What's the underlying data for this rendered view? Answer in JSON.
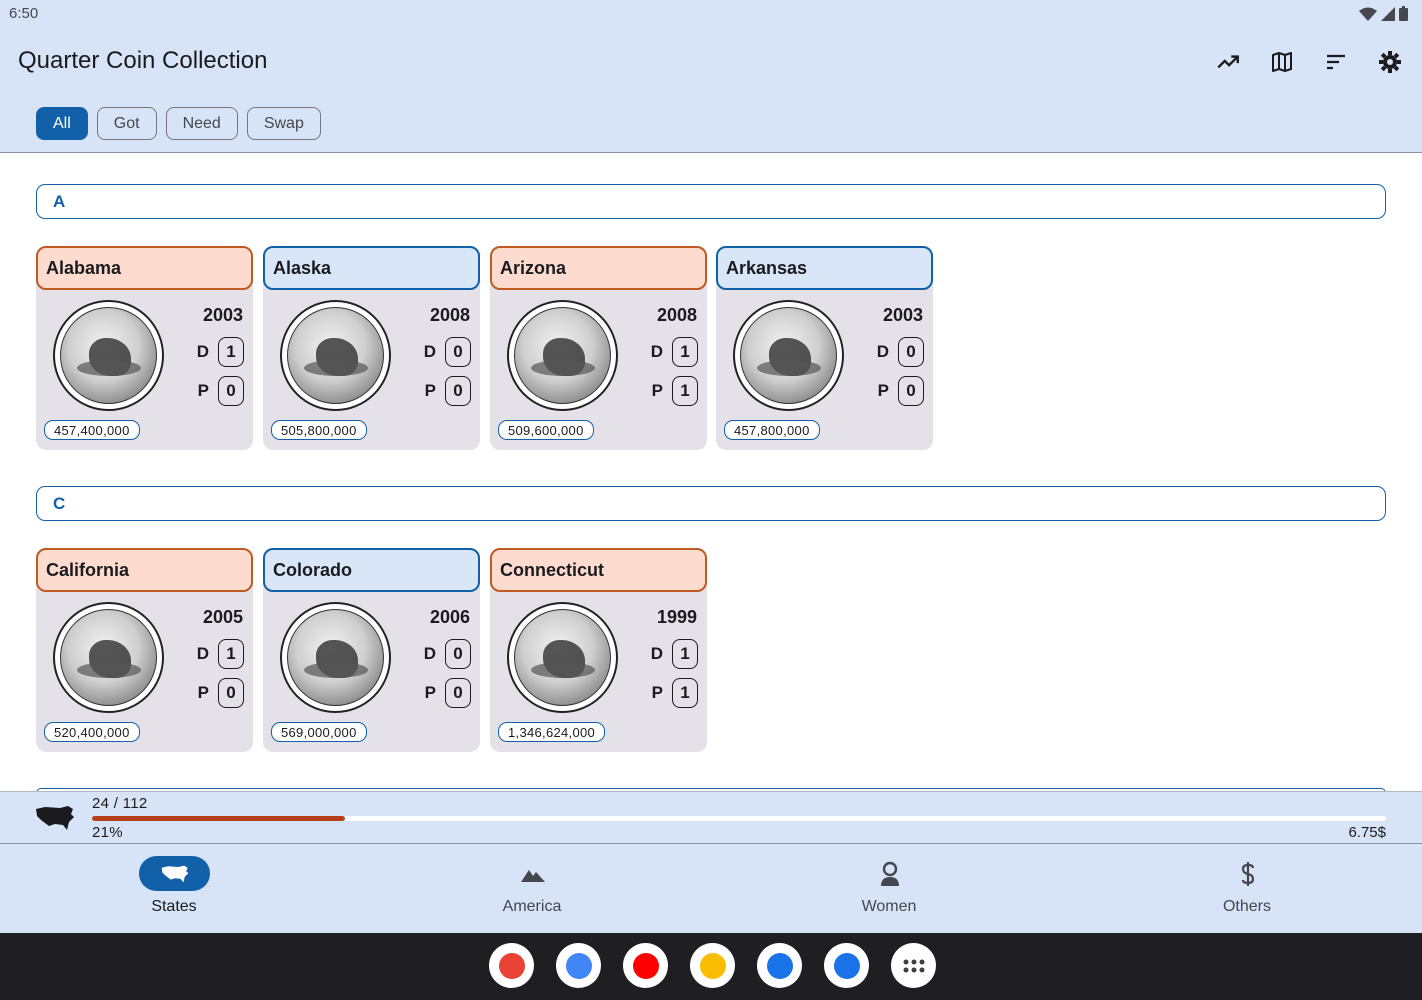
{
  "status": {
    "time": "6:50"
  },
  "app": {
    "title": "Quarter Coin Collection"
  },
  "actions": [
    {
      "name": "trend-icon"
    },
    {
      "name": "map-icon"
    },
    {
      "name": "sort-icon"
    },
    {
      "name": "gear-icon"
    }
  ],
  "filters": [
    {
      "label": "All",
      "active": true
    },
    {
      "label": "Got",
      "active": false
    },
    {
      "label": "Need",
      "active": false
    },
    {
      "label": "Swap",
      "active": false
    }
  ],
  "sections": [
    {
      "letter": "A",
      "coins": [
        {
          "state": "Alabama",
          "year": "2003",
          "d": "1",
          "p": "0",
          "mintage": "457,400,000",
          "style": "orange"
        },
        {
          "state": "Alaska",
          "year": "2008",
          "d": "0",
          "p": "0",
          "mintage": "505,800,000",
          "style": "blue"
        },
        {
          "state": "Arizona",
          "year": "2008",
          "d": "1",
          "p": "1",
          "mintage": "509,600,000",
          "style": "orange"
        },
        {
          "state": "Arkansas",
          "year": "2003",
          "d": "0",
          "p": "0",
          "mintage": "457,800,000",
          "style": "blue"
        }
      ]
    },
    {
      "letter": "C",
      "coins": [
        {
          "state": "California",
          "year": "2005",
          "d": "1",
          "p": "0",
          "mintage": "520,400,000",
          "style": "orange"
        },
        {
          "state": "Colorado",
          "year": "2006",
          "d": "0",
          "p": "0",
          "mintage": "569,000,000",
          "style": "blue"
        },
        {
          "state": "Connecticut",
          "year": "1999",
          "d": "1",
          "p": "1",
          "mintage": "1,346,624,000",
          "style": "orange"
        }
      ]
    }
  ],
  "mint_labels": {
    "d": "D",
    "p": "P"
  },
  "progress": {
    "count": "24 / 112",
    "percent_label": "21%",
    "fraction": 0.21,
    "value": "6.75$"
  },
  "nav": [
    {
      "label": "States",
      "icon": "us-map-icon",
      "active": true
    },
    {
      "label": "America",
      "icon": "mountain-icon",
      "active": false
    },
    {
      "label": "Women",
      "icon": "woman-icon",
      "active": false
    },
    {
      "label": "Others",
      "icon": "dollar-icon",
      "active": false
    }
  ],
  "dock": [
    {
      "name": "gmail-icon",
      "color": "#ea4335"
    },
    {
      "name": "chrome-icon",
      "color": "#4285f4"
    },
    {
      "name": "youtube-icon",
      "color": "#ff0000"
    },
    {
      "name": "photos-icon",
      "color": "#fbbc04"
    },
    {
      "name": "phone-icon",
      "color": "#1a73e8"
    },
    {
      "name": "messages-icon",
      "color": "#1a73e8"
    },
    {
      "name": "apps-icon",
      "color": "#3c4043"
    }
  ]
}
